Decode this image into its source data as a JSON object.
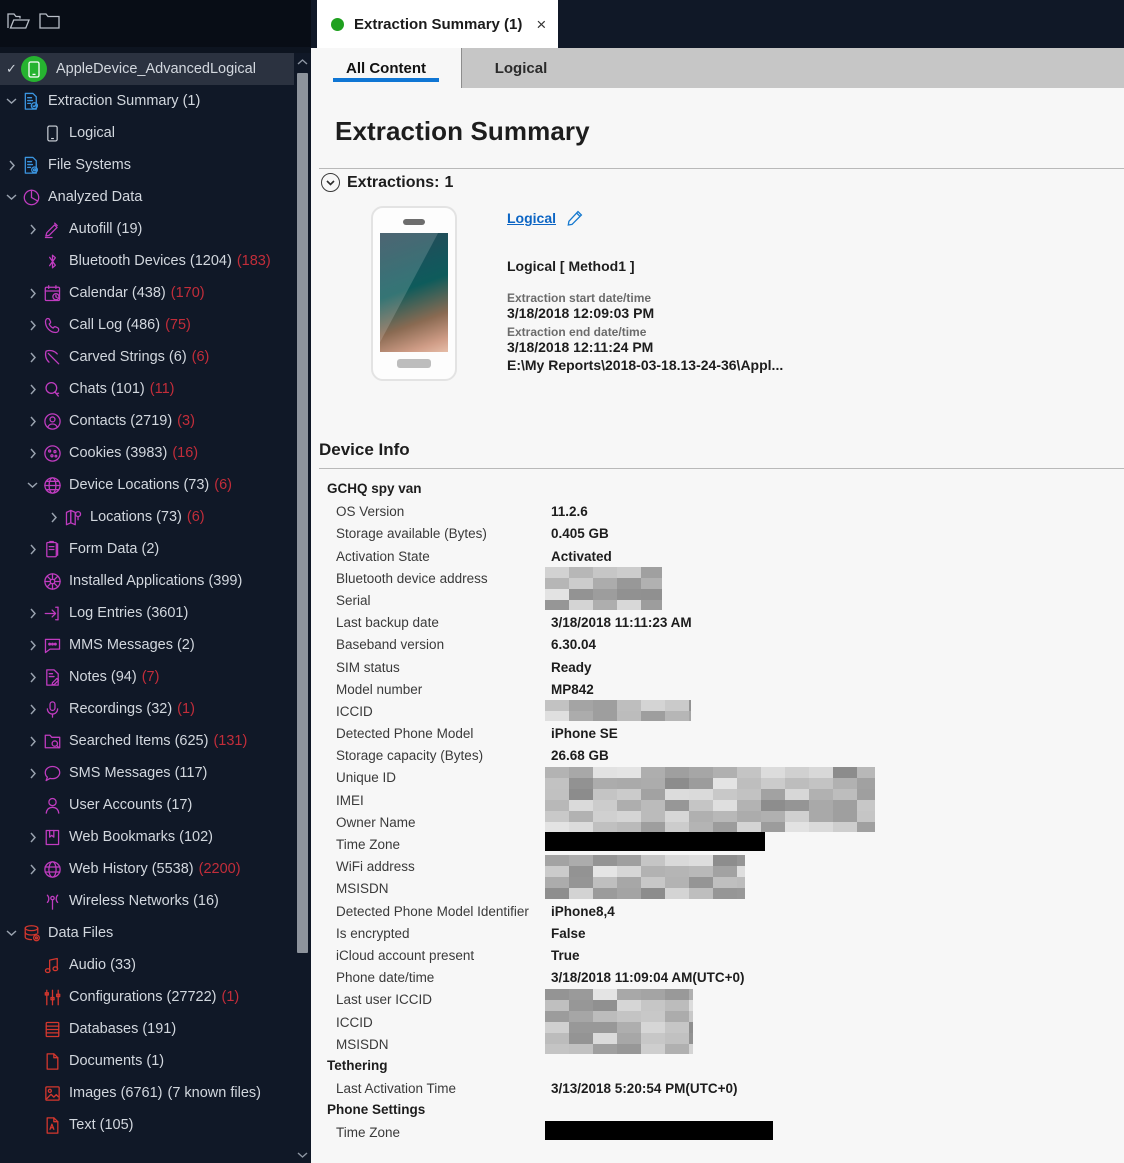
{
  "toolbar": {
    "icons": [
      {
        "name": "open-folder-icon",
        "label": "Open Folder"
      },
      {
        "name": "folder-icon",
        "label": "Folder"
      }
    ]
  },
  "sidebar": {
    "root": {
      "label": "AppleDevice_AdvancedLogical",
      "icon": "green-device-icon",
      "selected": true,
      "checked": true
    },
    "items": [
      {
        "label": "Extraction Summary (1)",
        "icon": "report-icon",
        "indent": 1,
        "twisty": "down",
        "color": "#3b95e0"
      },
      {
        "label": "Logical",
        "icon": "phone-icon",
        "indent": 2,
        "twisty": "none",
        "color": "#d2d7de"
      },
      {
        "label": "File Systems",
        "icon": "filesystem-icon",
        "indent": 1,
        "twisty": "right",
        "color": "#3b95e0"
      },
      {
        "label": "Analyzed Data",
        "icon": "pie-icon",
        "indent": 1,
        "twisty": "down",
        "color": "#c03cc0"
      },
      {
        "label": "Autofill (19)",
        "icon": "autofill-icon",
        "indent": 2,
        "twisty": "right",
        "color": "#c03cc0"
      },
      {
        "label": "Bluetooth Devices (1204)",
        "red": "(183)",
        "icon": "bluetooth-icon",
        "indent": 2,
        "twisty": "none",
        "color": "#c03cc0"
      },
      {
        "label": "Calendar (438)",
        "red": "(170)",
        "icon": "calendar-icon",
        "indent": 2,
        "twisty": "right",
        "color": "#c03cc0"
      },
      {
        "label": "Call Log (486)",
        "red": "(75)",
        "icon": "phonecall-icon",
        "indent": 2,
        "twisty": "right",
        "color": "#c03cc0"
      },
      {
        "label": "Carved Strings (6)",
        "red": "(6)",
        "icon": "pickaxe-icon",
        "indent": 2,
        "twisty": "right",
        "color": "#c03cc0"
      },
      {
        "label": "Chats (101)",
        "red": "(11)",
        "icon": "chat-icon",
        "indent": 2,
        "twisty": "right",
        "color": "#c03cc0"
      },
      {
        "label": "Contacts (2719)",
        "red": "(3)",
        "icon": "contact-icon",
        "indent": 2,
        "twisty": "right",
        "color": "#c03cc0"
      },
      {
        "label": "Cookies (3983)",
        "red": "(16)",
        "icon": "cookie-icon",
        "indent": 2,
        "twisty": "right",
        "color": "#c03cc0"
      },
      {
        "label": "Device Locations (73)",
        "red": "(6)",
        "icon": "globe-grid-icon",
        "indent": 2,
        "twisty": "down",
        "color": "#c03cc0"
      },
      {
        "label": "Locations (73)",
        "red": "(6)",
        "icon": "map-icon",
        "indent": 3,
        "twisty": "right",
        "color": "#c03cc0"
      },
      {
        "label": "Form Data (2)",
        "icon": "form-icon",
        "indent": 2,
        "twisty": "right",
        "color": "#c03cc0"
      },
      {
        "label": "Installed Applications (399)",
        "icon": "apps-icon",
        "indent": 2,
        "twisty": "none",
        "color": "#c03cc0"
      },
      {
        "label": "Log Entries (3601)",
        "icon": "login-arrow-icon",
        "indent": 2,
        "twisty": "right",
        "color": "#c03cc0"
      },
      {
        "label": "MMS Messages (2)",
        "icon": "mms-icon",
        "indent": 2,
        "twisty": "right",
        "color": "#c03cc0"
      },
      {
        "label": "Notes (94)",
        "red": "(7)",
        "icon": "note-icon",
        "indent": 2,
        "twisty": "right",
        "color": "#c03cc0"
      },
      {
        "label": "Recordings (32)",
        "red": "(1)",
        "icon": "mic-icon",
        "indent": 2,
        "twisty": "right",
        "color": "#c03cc0"
      },
      {
        "label": "Searched Items (625)",
        "red": "(131)",
        "icon": "searchfolder-icon",
        "indent": 2,
        "twisty": "right",
        "color": "#c03cc0"
      },
      {
        "label": "SMS Messages (117)",
        "icon": "sms-icon",
        "indent": 2,
        "twisty": "right",
        "color": "#c03cc0"
      },
      {
        "label": "User Accounts (17)",
        "icon": "user-icon",
        "indent": 2,
        "twisty": "none",
        "color": "#c03cc0"
      },
      {
        "label": "Web Bookmarks (102)",
        "icon": "bookmark-icon",
        "indent": 2,
        "twisty": "right",
        "color": "#c03cc0"
      },
      {
        "label": "Web History (5538)",
        "red": "(2200)",
        "icon": "web-globe-icon",
        "indent": 2,
        "twisty": "right",
        "color": "#c03cc0"
      },
      {
        "label": "Wireless Networks (16)",
        "icon": "wifi-icon",
        "indent": 2,
        "twisty": "none",
        "color": "#c03cc0"
      },
      {
        "label": "Data Files",
        "icon": "database-icon",
        "indent": 1,
        "twisty": "down",
        "color": "#d4372e"
      },
      {
        "label": "Audio (33)",
        "icon": "audio-icon",
        "indent": 2,
        "twisty": "none",
        "color": "#d4372e"
      },
      {
        "label": "Configurations (27722)",
        "red": "(1)",
        "icon": "sliders-icon",
        "indent": 2,
        "twisty": "none",
        "color": "#d4372e"
      },
      {
        "label": "Databases (191)",
        "icon": "db-stack-icon",
        "indent": 2,
        "twisty": "none",
        "color": "#d4372e"
      },
      {
        "label": "Documents (1)",
        "icon": "document-icon",
        "indent": 2,
        "twisty": "none",
        "color": "#d4372e"
      },
      {
        "label": "Images (6761)",
        "gray": "(7 known files)",
        "icon": "image-icon",
        "indent": 2,
        "twisty": "none",
        "color": "#d4372e"
      },
      {
        "label": "Text (105)",
        "icon": "text-icon",
        "indent": 2,
        "twisty": "none",
        "color": "#d4372e"
      }
    ]
  },
  "tab": {
    "title": "Extraction Summary (1)",
    "close_label": "×",
    "status_color": "#1fa01f"
  },
  "subtabs": [
    {
      "label": "All Content",
      "active": true
    },
    {
      "label": "Logical",
      "active": false
    }
  ],
  "page": {
    "title": "Extraction Summary",
    "extractions_label": "Extractions:",
    "extractions_count": "1",
    "device_info_title": "Device Info"
  },
  "extraction": {
    "link": "Logical",
    "method": "Logical [ Method1 ]",
    "start_key": "Extraction start date/time",
    "start_value": "3/18/2018 12:09:03 PM",
    "end_key": "Extraction end date/time",
    "end_value": "3/18/2018 12:11:24 PM",
    "path": "E:\\My Reports\\2018-03-18.13-24-36\\Appl..."
  },
  "device_info": [
    {
      "type": "group",
      "label": "GCHQ spy van"
    },
    {
      "type": "row",
      "key": "OS Version",
      "value": "11.2.6"
    },
    {
      "type": "row",
      "key": "Storage available (Bytes)",
      "value": "0.405 GB"
    },
    {
      "type": "row",
      "key": "Activation State",
      "value": "Activated"
    },
    {
      "type": "row",
      "key": "Bluetooth device address",
      "value": "",
      "redacted": "blur"
    },
    {
      "type": "row",
      "key": "Serial",
      "value": "",
      "redacted": "blur"
    },
    {
      "type": "row",
      "key": "Last backup date",
      "value": "3/18/2018 11:11:23 AM"
    },
    {
      "type": "row",
      "key": "Baseband version",
      "value": "6.30.04"
    },
    {
      "type": "row",
      "key": "SIM status",
      "value": "Ready"
    },
    {
      "type": "row",
      "key": "Model number",
      "value": "MP842"
    },
    {
      "type": "row",
      "key": "ICCID",
      "value": "",
      "redacted": "blur"
    },
    {
      "type": "row",
      "key": "Detected Phone Model",
      "value": "iPhone SE"
    },
    {
      "type": "row",
      "key": "Storage capacity (Bytes)",
      "value": "26.68 GB"
    },
    {
      "type": "row",
      "key": "Unique ID",
      "value": "",
      "redacted": "blur"
    },
    {
      "type": "row",
      "key": "IMEI",
      "value": "",
      "redacted": "blur"
    },
    {
      "type": "row",
      "key": "Owner Name",
      "value": "",
      "redacted": "blur"
    },
    {
      "type": "row",
      "key": "Time Zone",
      "value": "",
      "redacted": "bar"
    },
    {
      "type": "row",
      "key": "WiFi address",
      "value": "",
      "redacted": "blur"
    },
    {
      "type": "row",
      "key": "MSISDN",
      "value": "",
      "redacted": "blur"
    },
    {
      "type": "row",
      "key": "Detected Phone Model Identifier",
      "value": "iPhone8,4"
    },
    {
      "type": "row",
      "key": "Is encrypted",
      "value": "False"
    },
    {
      "type": "row",
      "key": "iCloud account present",
      "value": "True"
    },
    {
      "type": "row",
      "key": "Phone date/time",
      "value": "3/18/2018 11:09:04 AM(UTC+0)"
    },
    {
      "type": "row",
      "key": "Last user ICCID",
      "value": "",
      "redacted": "blur"
    },
    {
      "type": "row",
      "key": "ICCID",
      "value": "",
      "redacted": "blur"
    },
    {
      "type": "row",
      "key": "MSISDN",
      "value": "",
      "redacted": "blur"
    },
    {
      "type": "group",
      "label": "Tethering"
    },
    {
      "type": "row",
      "key": "Last Activation Time",
      "value": "3/13/2018 5:20:54 PM(UTC+0)"
    },
    {
      "type": "group",
      "label": "Phone Settings"
    },
    {
      "type": "row",
      "key": "Time Zone",
      "value": "",
      "redacted": "bar"
    }
  ]
}
